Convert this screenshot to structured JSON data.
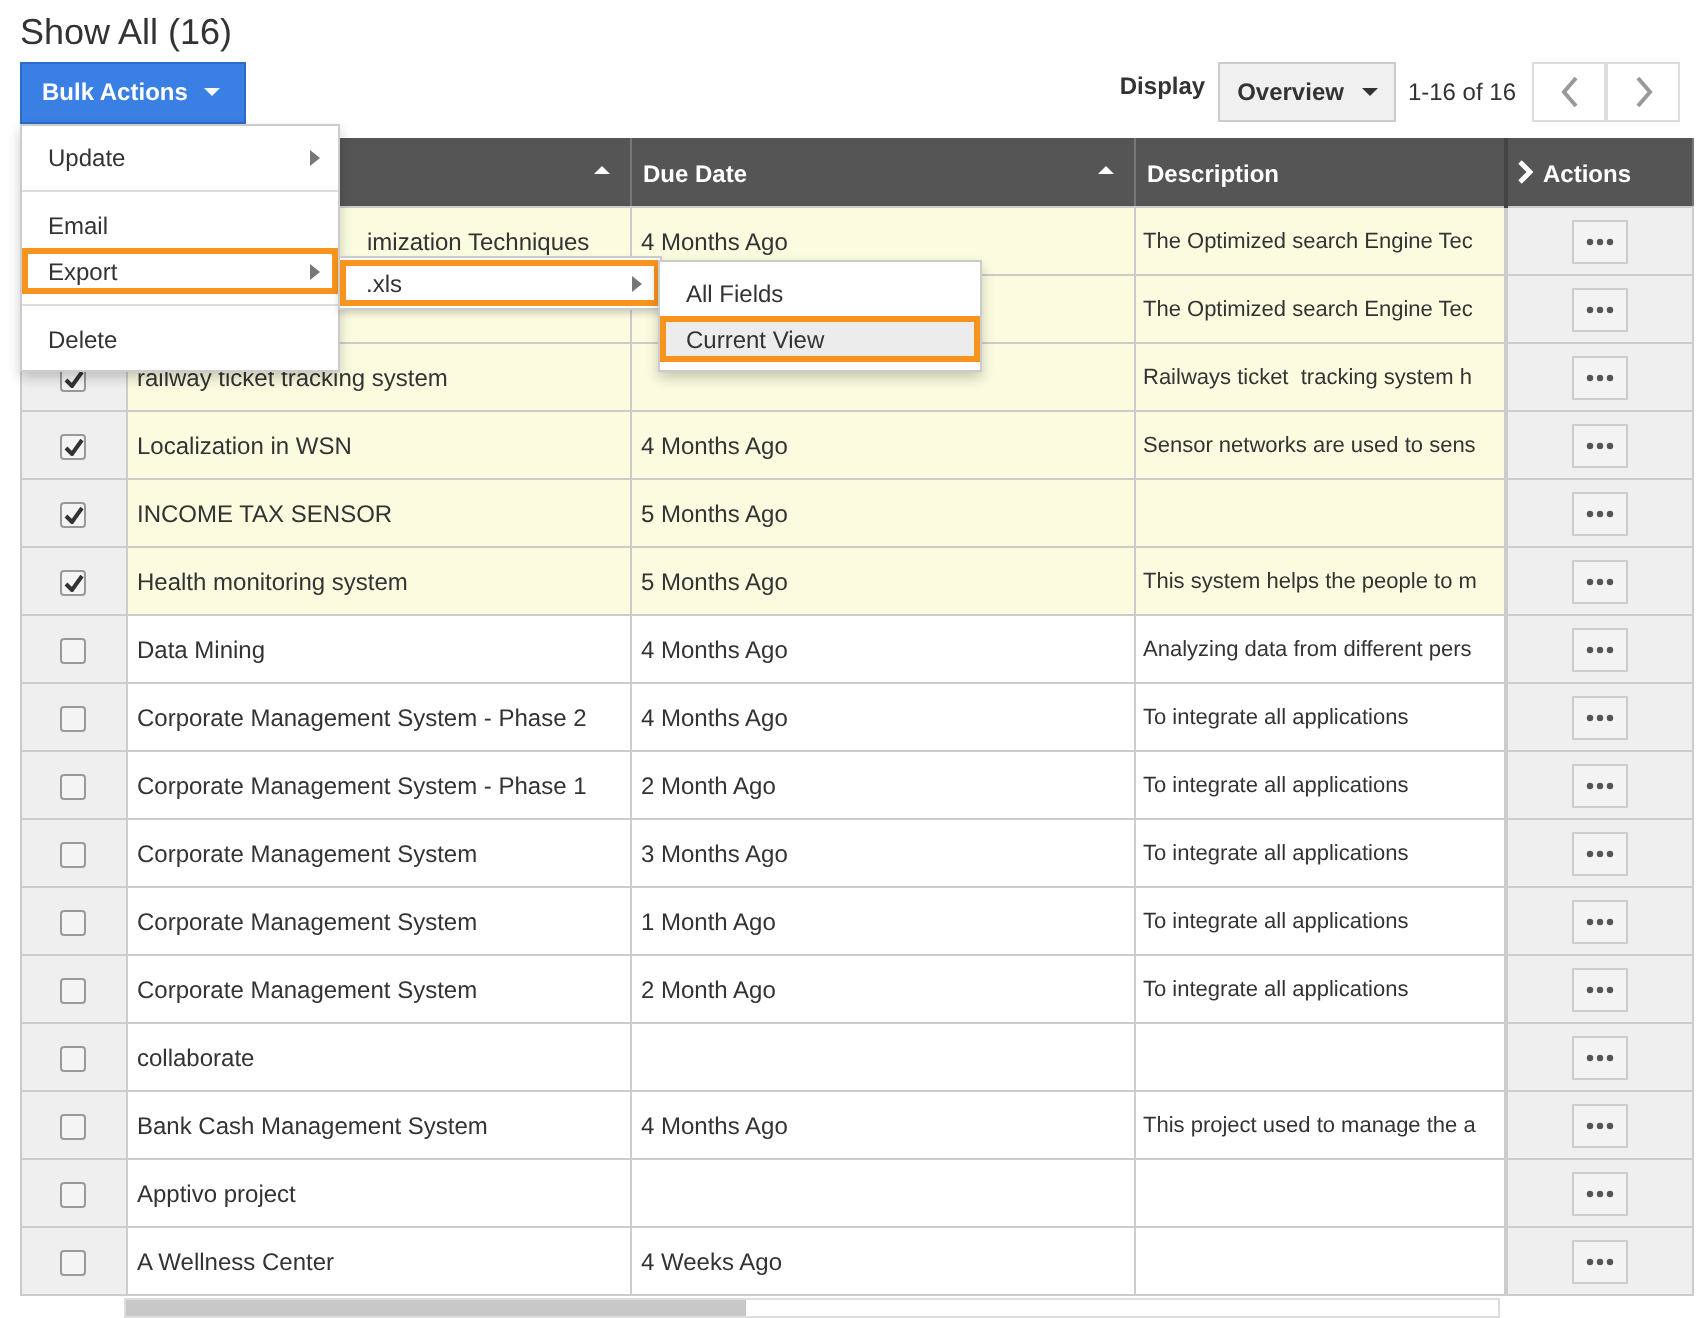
{
  "title": "Show All (16)",
  "bulk_button": {
    "label": "Bulk Actions"
  },
  "display": {
    "label": "Display",
    "value": "Overview",
    "range": "1-16 of 16"
  },
  "table": {
    "columns": [
      {
        "sort": true
      },
      {
        "label": "Due Date",
        "sort": true
      },
      {
        "label": "Description",
        "sort": false
      },
      {
        "label": "Actions",
        "sort": false
      }
    ],
    "rows": [
      {
        "kind": "covered",
        "checked": true,
        "name": "imization Techniques",
        "due": "4 Months Ago",
        "description": "The Optimized search Engine Tec"
      },
      {
        "kind": "covered",
        "checked": true,
        "description": "The Optimized search Engine Tec"
      },
      {
        "checked": true,
        "name": "railway ticket tracking system",
        "description": "Railways ticket  tracking system h"
      },
      {
        "checked": true,
        "name": "Localization in WSN",
        "due": "4 Months Ago",
        "description": "Sensor networks are used to sens"
      },
      {
        "checked": true,
        "name": "INCOME TAX SENSOR",
        "due": "5 Months Ago"
      },
      {
        "checked": true,
        "name": "Health monitoring system",
        "due": "5 Months Ago",
        "description": "This system helps the people to m"
      },
      {
        "checked": false,
        "name": "Data Mining",
        "due": "4 Months Ago",
        "description": "Analyzing data from different pers"
      },
      {
        "checked": false,
        "name": "Corporate Management System - Phase 2",
        "due": "4 Months Ago",
        "description": "To integrate all applications"
      },
      {
        "checked": false,
        "name": "Corporate Management System - Phase 1",
        "due": "2 Month Ago",
        "description": "To integrate all applications"
      },
      {
        "checked": false,
        "name": "Corporate Management System",
        "due": "3 Months Ago",
        "description": "To integrate all applications"
      },
      {
        "checked": false,
        "name": "Corporate Management System",
        "due": "1 Month Ago",
        "description": "To integrate all applications"
      },
      {
        "checked": false,
        "name": "Corporate Management System",
        "due": "2 Month Ago",
        "description": "To integrate all applications"
      },
      {
        "checked": false,
        "name": "collaborate"
      },
      {
        "checked": false,
        "name": "Bank Cash Management System",
        "due": "4 Months Ago",
        "description": "This project used to manage the a"
      },
      {
        "checked": false,
        "name": "Apptivo project"
      },
      {
        "checked": false,
        "name": "A Wellness Center",
        "due": "4 Weeks Ago"
      }
    ]
  },
  "menu": {
    "items": [
      {
        "label": "Update",
        "submenu": true,
        "highlighted": false,
        "divider_after": true
      },
      {
        "label": "Email",
        "submenu": false,
        "highlighted": false,
        "divider_after": false
      },
      {
        "label": "Export",
        "submenu": true,
        "highlighted": true,
        "divider_after": true
      },
      {
        "label": "Delete",
        "submenu": false,
        "highlighted": false,
        "divider_after": false
      }
    ]
  },
  "submenu": {
    "items": [
      {
        "label": ".xls",
        "submenu": true,
        "highlighted": true
      }
    ]
  },
  "subsubmenu": {
    "items": [
      {
        "label": "All Fields",
        "highlighted": false
      },
      {
        "label": "Current View",
        "highlighted": true
      }
    ]
  }
}
